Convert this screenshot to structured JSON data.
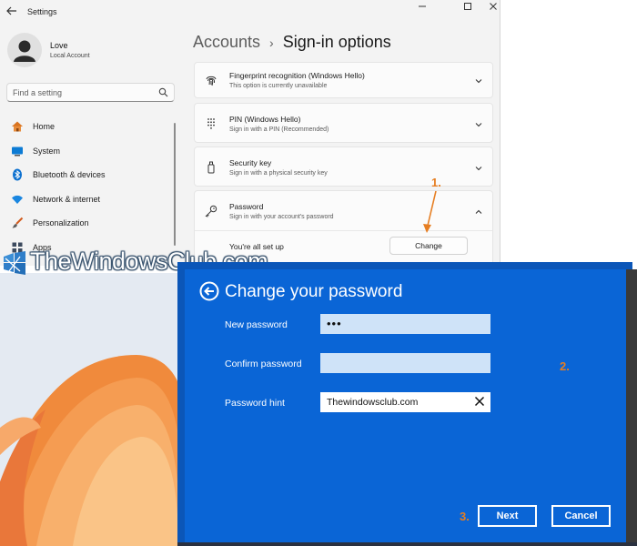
{
  "settings": {
    "app_title": "Settings",
    "user": {
      "name": "Love",
      "account_type": "Local Account"
    },
    "search": {
      "placeholder": "Find a setting"
    },
    "nav": [
      {
        "label": "Home",
        "icon": "home-icon"
      },
      {
        "label": "System",
        "icon": "monitor-icon"
      },
      {
        "label": "Bluetooth & devices",
        "icon": "bluetooth-icon"
      },
      {
        "label": "Network & internet",
        "icon": "wifi-icon"
      },
      {
        "label": "Personalization",
        "icon": "brush-icon"
      },
      {
        "label": "Apps",
        "icon": "apps-icon"
      }
    ],
    "breadcrumb": {
      "parent": "Accounts",
      "separator": "›",
      "current": "Sign-in options"
    },
    "cards": [
      {
        "title": "Fingerprint recognition (Windows Hello)",
        "subtitle": "This option is currently unavailable",
        "icon": "fingerprint-icon"
      },
      {
        "title": "PIN (Windows Hello)",
        "subtitle": "Sign in with a PIN (Recommended)",
        "icon": "pin-keypad-icon"
      },
      {
        "title": "Security key",
        "subtitle": "Sign in with a physical security key",
        "icon": "usb-key-icon"
      },
      {
        "title": "Password",
        "subtitle": "Sign in with your account's password",
        "icon": "key-icon"
      }
    ],
    "password_status": "You're all set up",
    "change_button": "Change"
  },
  "watermark": {
    "text": "TheWindowsClub.com"
  },
  "annotations": {
    "step1": "1.",
    "step2": "2.",
    "step3": "3.",
    "color": "#e67e22"
  },
  "dialog": {
    "title": "Change your password",
    "new_password_label": "New password",
    "new_password_value": "•••",
    "confirm_password_label": "Confirm password",
    "confirm_password_value": "",
    "hint_label": "Password hint",
    "hint_value": "Thewindowsclub.com",
    "next_button": "Next",
    "cancel_button": "Cancel",
    "accent_color": "#0a65d6"
  }
}
